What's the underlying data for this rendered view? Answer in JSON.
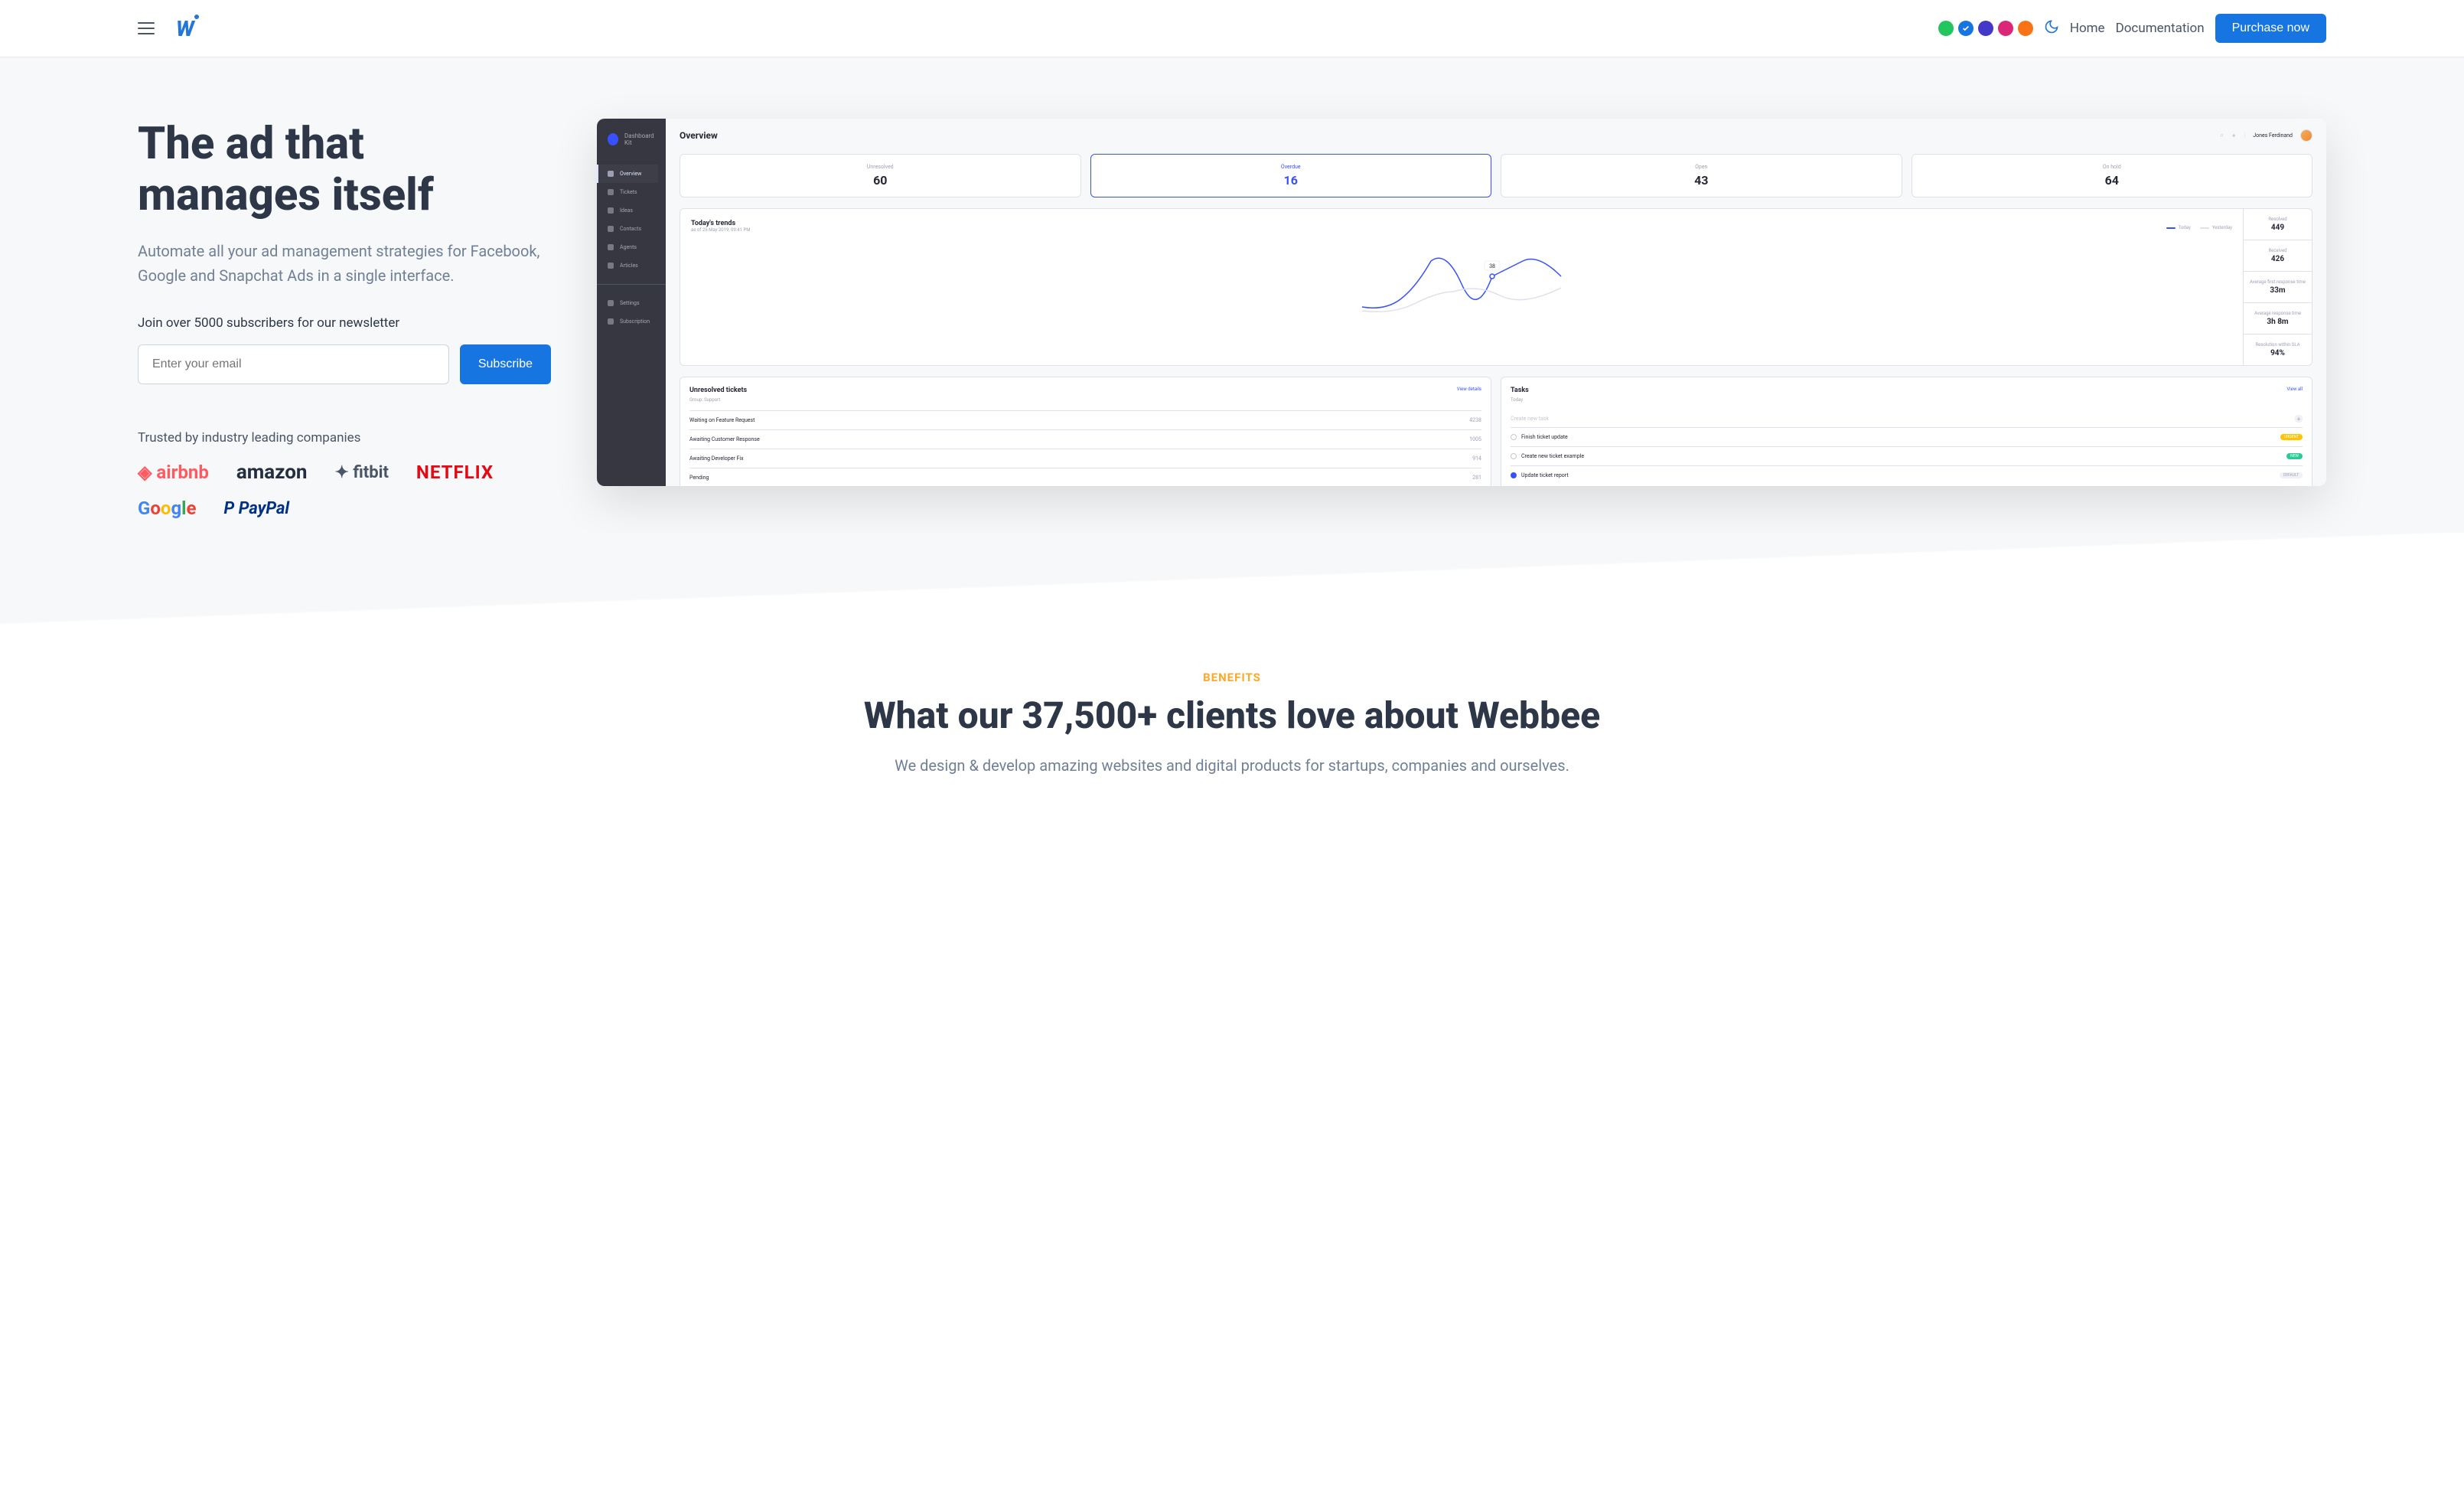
{
  "nav": {
    "home": "Home",
    "docs": "Documentation",
    "purchase": "Purchase now"
  },
  "color_swatches": [
    "#22c55e",
    "#1675e0",
    "#4338ca",
    "#db2777",
    "#f97316"
  ],
  "hero": {
    "title": "The ad that manages itself",
    "subtitle": "Automate all your ad management strategies for Facebook, Google and Snapchat Ads in a single interface.",
    "newsletter_label": "Join over 5000 subscribers for our newsletter",
    "email_placeholder": "Enter your email",
    "subscribe": "Subscribe",
    "trusted": "Trusted by industry leading companies"
  },
  "brands": {
    "airbnb": "airbnb",
    "amazon": "amazon",
    "fitbit": "fitbit",
    "netflix": "NETFLIX",
    "paypal": "PayPal"
  },
  "dashboard": {
    "kit": "Dashboard Kit",
    "title": "Overview",
    "user": "Jones Ferdinand",
    "sidebar": {
      "overview": "Overview",
      "tickets": "Tickets",
      "ideas": "Ideas",
      "contacts": "Contacts",
      "agents": "Agents",
      "articles": "Articles",
      "settings": "Settings",
      "subscription": "Subscription"
    },
    "stats": [
      {
        "label": "Unresolved",
        "value": "60"
      },
      {
        "label": "Overdue",
        "value": "16"
      },
      {
        "label": "Open",
        "value": "43"
      },
      {
        "label": "On hold",
        "value": "64"
      }
    ],
    "trends": {
      "title": "Today's trends",
      "subtitle": "as of 25 May 2019, 09:41 PM",
      "legend_today": "Today",
      "legend_yesterday": "Yesterday",
      "point_label": "38"
    },
    "metrics": [
      {
        "label": "Resolved",
        "value": "449"
      },
      {
        "label": "Received",
        "value": "426"
      },
      {
        "label": "Average first response time",
        "value": "33m"
      },
      {
        "label": "Average response time",
        "value": "3h 8m"
      },
      {
        "label": "Resolution within SLA",
        "value": "94%"
      }
    ],
    "unresolved": {
      "title": "Unresolved tickets",
      "link": "View details",
      "group": "Group: Support",
      "rows": [
        {
          "name": "Waiting on Feature Request",
          "val": "4238"
        },
        {
          "name": "Awaiting Customer Response",
          "val": "1005"
        },
        {
          "name": "Awaiting Developer Fix",
          "val": "914"
        },
        {
          "name": "Pending",
          "val": "281"
        }
      ]
    },
    "tasks": {
      "title": "Tasks",
      "link": "View all",
      "sub": "Today",
      "create": "Create new task",
      "rows": [
        {
          "name": "Finish ticket update",
          "badge": "URGENT",
          "color": "#fec400",
          "done": false
        },
        {
          "name": "Create new ticket example",
          "badge": "NEW",
          "color": "#29cc97",
          "done": false
        },
        {
          "name": "Update ticket report",
          "badge": "DEFAULT",
          "color": "#f0f1f7",
          "badge_text": "#9fa2b4",
          "done": true
        }
      ]
    }
  },
  "benefits": {
    "label": "BENEFITS",
    "title": "What our 37,500+ clients love about Webbee",
    "subtitle": "We design & develop amazing websites and digital products for startups, companies and ourselves."
  }
}
